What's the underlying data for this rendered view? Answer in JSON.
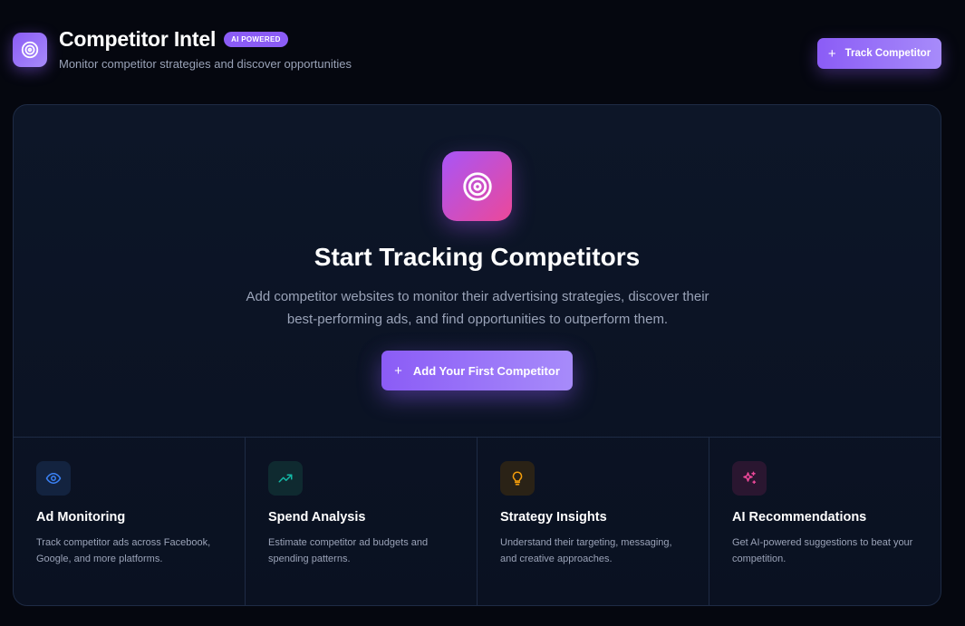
{
  "header": {
    "title": "Competitor Intel",
    "badge": "AI POWERED",
    "subtitle": "Monitor competitor strategies and discover opportunities",
    "track_button": "Track Competitor",
    "logo_icon": "target-icon"
  },
  "hero": {
    "icon": "target-icon",
    "title": "Start Tracking Competitors",
    "description": "Add competitor websites to monitor their advertising strategies, discover their best-performing ads, and find opportunities to outperform them.",
    "cta": "Add Your First Competitor"
  },
  "features": [
    {
      "icon": "eye-icon",
      "title": "Ad Monitoring",
      "description": "Track competitor ads across Facebook, Google, and more platforms.",
      "color": "#3b82f6"
    },
    {
      "icon": "trending-up-icon",
      "title": "Spend Analysis",
      "description": "Estimate competitor ad budgets and spending patterns.",
      "color": "#14b8a6"
    },
    {
      "icon": "lightbulb-icon",
      "title": "Strategy Insights",
      "description": "Understand their targeting, messaging, and creative approaches.",
      "color": "#f59e0b"
    },
    {
      "icon": "sparkles-icon",
      "title": "AI Recommendations",
      "description": "Get AI-powered suggestions to beat your competition.",
      "color": "#ec4899"
    }
  ],
  "colors": {
    "accent": "#8b5cf6",
    "accent_light": "#a78bfa",
    "background": "#05070f",
    "card": "#0d1628"
  }
}
